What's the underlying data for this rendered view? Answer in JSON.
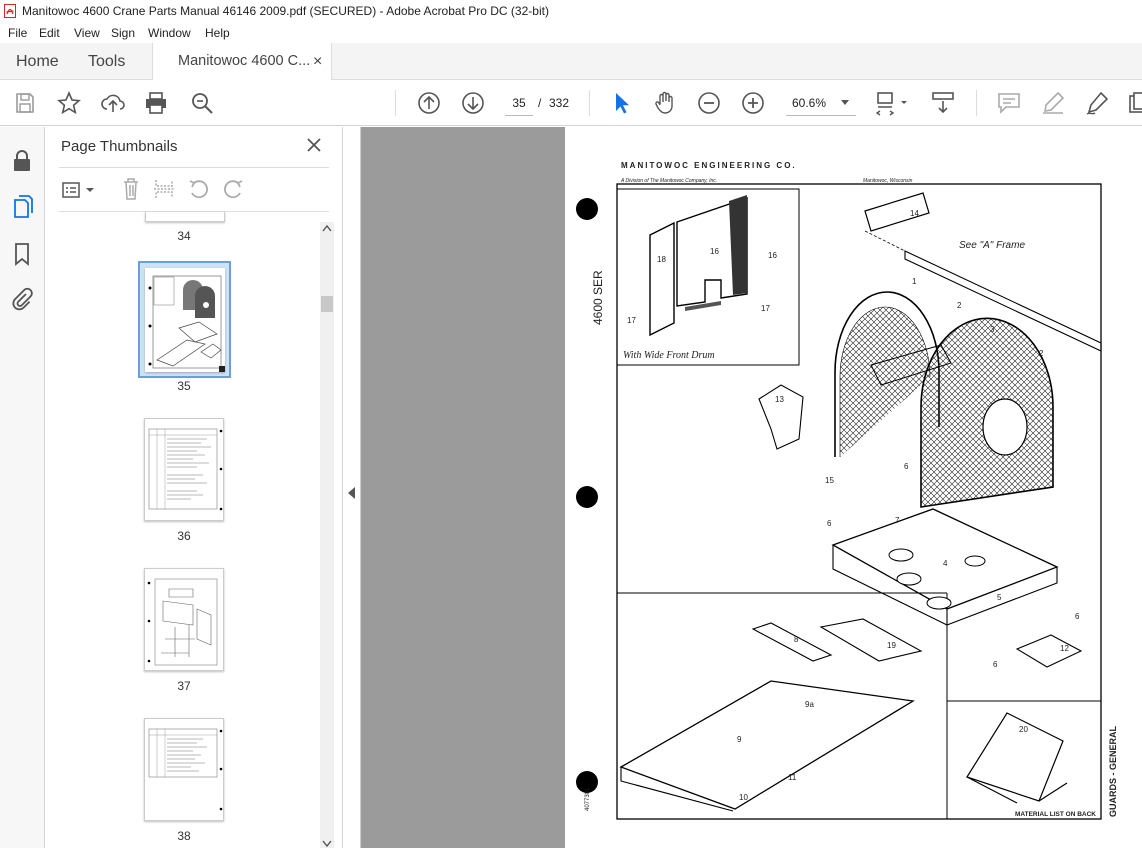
{
  "window": {
    "title": "Manitowoc 4600 Crane Parts Manual 46146 2009.pdf (SECURED) - Adobe Acrobat Pro DC (32-bit)",
    "icon": "acrobat-pdf-icon"
  },
  "menu": {
    "items": [
      "File",
      "Edit",
      "View",
      "Sign",
      "Window",
      "Help"
    ]
  },
  "tabs": {
    "home": "Home",
    "tools": "Tools",
    "document": "Manitowoc 4600 C...",
    "close_glyph": "×"
  },
  "toolbar": {
    "icons": [
      "save-icon",
      "star-icon",
      "upload-icon",
      "print-icon",
      "zoom-search-icon",
      "page-up-icon",
      "page-down-icon",
      "select-cursor-icon",
      "hand-icon",
      "zoom-out-icon",
      "zoom-in-icon",
      "page-fit-icon",
      "scroll-mode-icon",
      "comment-icon",
      "highlight-icon",
      "sign-icon",
      "more-icon"
    ],
    "current_page": "35",
    "page_separator": "/",
    "total_pages": "332",
    "zoom": "60.6%",
    "accent_color": "#1473e6"
  },
  "left_rail": {
    "icons": [
      "lock-icon",
      "pages-icon",
      "bookmark-icon",
      "attachment-icon"
    ]
  },
  "thumbnails_panel": {
    "title": "Page Thumbnails",
    "close_glyph": "✕",
    "actions": [
      "options-icon",
      "delete-icon",
      "extract-icon",
      "rotate-ccw-icon",
      "rotate-cw-icon"
    ],
    "pages": [
      {
        "label": "34",
        "selected": false
      },
      {
        "label": "35",
        "selected": true
      },
      {
        "label": "36",
        "selected": false
      },
      {
        "label": "37",
        "selected": false
      },
      {
        "label": "38",
        "selected": false
      }
    ]
  },
  "document_page": {
    "header": "MANITOWOC ENGINEERING CO.",
    "subheader_left": "A Division of The Manitowoc Company, Inc.",
    "subheader_right": "Manitowoc, Wisconsin",
    "side_text_left": "4600 SER",
    "inset_caption": "With Wide Front Drum",
    "frame_note": "See \"A\" Frame",
    "right_vertical_title": "GUARDS - GENERAL",
    "footer_note": "MATERIAL LIST ON BACK",
    "left_code": "4077301",
    "callouts": [
      "1",
      "2",
      "2",
      "3",
      "4",
      "5",
      "6",
      "6",
      "6",
      "6",
      "7",
      "8",
      "9",
      "9a",
      "10",
      "11",
      "12",
      "13",
      "14",
      "15",
      "16",
      "16",
      "17",
      "17",
      "18",
      "19",
      "20"
    ]
  }
}
